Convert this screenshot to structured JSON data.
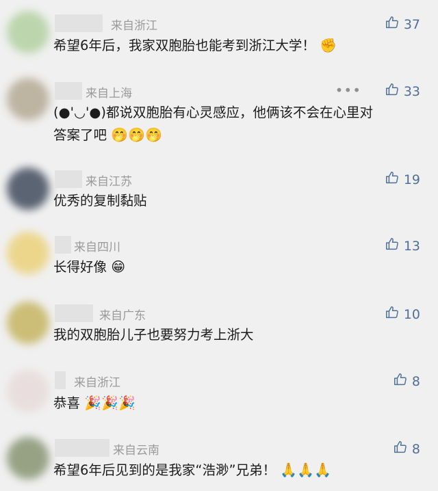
{
  "comments": [
    {
      "region": "来自浙江",
      "likes": "37",
      "text": "希望6年后，我家双胞胎也能考到浙江大学！",
      "emoji": "✊"
    },
    {
      "region": "来自上海",
      "likes": "33",
      "more": "•••",
      "text": "(●'◡'●)都说双胞胎有心灵感应，他俩该不会在心里对答案了吧",
      "emoji": "🤭🤭🤭"
    },
    {
      "region": "来自江苏",
      "likes": "19",
      "text": "优秀的复制黏贴",
      "emoji": ""
    },
    {
      "region": "来自四川",
      "likes": "13",
      "text": "长得好像",
      "emoji": "😁"
    },
    {
      "region": "来自广东",
      "likes": "10",
      "text": "我的双胞胎儿子也要努力考上浙大",
      "emoji": ""
    },
    {
      "region": "来自浙江",
      "likes": "8",
      "text": "恭喜",
      "emoji": "🎉🎉🎉"
    },
    {
      "region": "来自云南",
      "likes": "8",
      "text": "希望6年后见到的是我家“浩渺”兄弟！",
      "emoji": "🙏🙏🙏"
    }
  ],
  "colors": {
    "avatar_1": "#b7d3a6",
    "avatar_2": "#b9ae9a",
    "avatar_3": "#4b5566",
    "avatar_4": "#ecd482",
    "avatar_5": "#c9b86a",
    "avatar_6": "#e9dcdc",
    "avatar_7": "#8e9a7a"
  }
}
